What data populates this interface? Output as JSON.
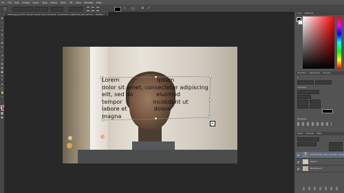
{
  "menubar": {
    "items": [
      "Ps",
      "File",
      "Edit",
      "Image",
      "Layer",
      "Type",
      "Select",
      "Filter",
      "3D",
      "View",
      "Window",
      "Help"
    ]
  },
  "document": {
    "tab_title": "statue.jpg @ 50% (Lorem ipsum dolor sit amet, consectetur adipiscing elit, sed do..., RGB/8) *"
  },
  "canvas": {
    "text_lines": [
      "Lorem                     ipsum",
      "dolor sit amet, consectetur adipiscing",
      "elit, sed do             eiusmod",
      "tempor                 incididunt ut",
      "labore et               dolore",
      "magna"
    ]
  },
  "panels": {
    "color_tabs": [
      "Color",
      "Swatches"
    ],
    "properties_tabs": [
      "Properties",
      "Adjustments",
      "Libraries"
    ],
    "character_label": "Character",
    "paragraph_label": "Paragraph",
    "layers_tabs": [
      "Layers",
      "Channels",
      "Paths"
    ],
    "layers": [
      {
        "name": "Lorem ipsum dolor sit amet, consectetur adipisc"
      },
      {
        "name": "Layer 1"
      },
      {
        "name": "Background"
      }
    ]
  },
  "colors": {
    "foreground": "#000000",
    "background": "#ffffff",
    "accent_red": "#c0302a"
  }
}
